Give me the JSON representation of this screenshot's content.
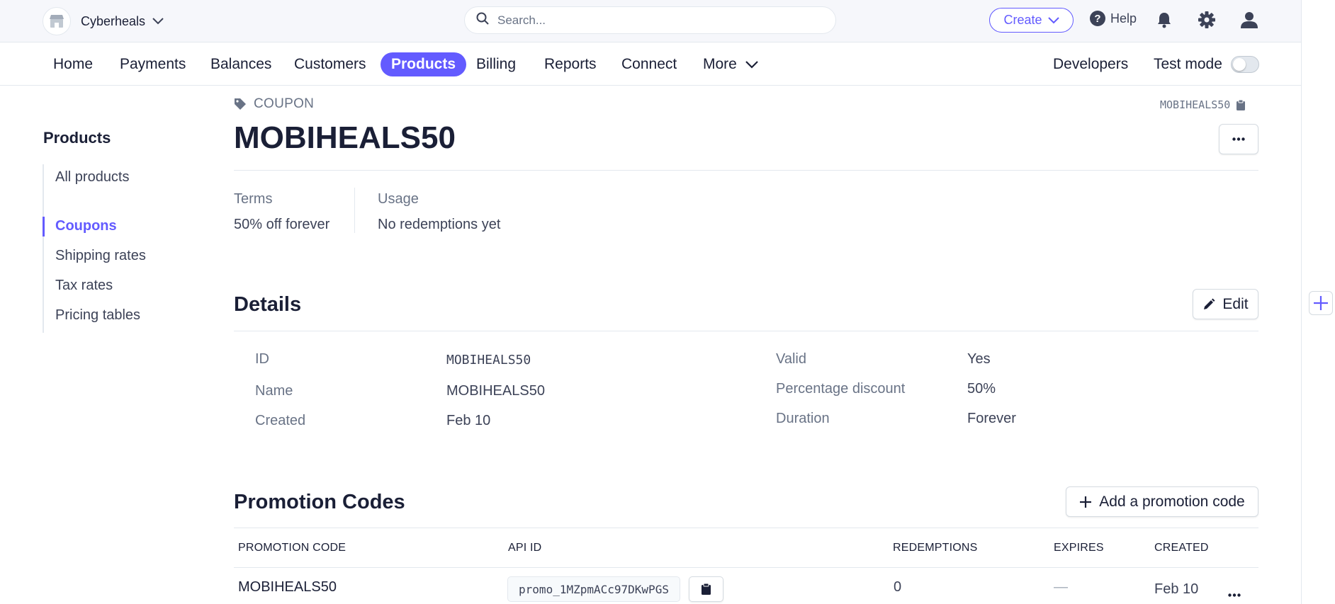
{
  "topbar": {
    "account_name": "Cyberheals",
    "search_placeholder": "Search...",
    "create_label": "Create",
    "help_label": "Help"
  },
  "nav": {
    "items": [
      "Home",
      "Payments",
      "Balances",
      "Customers",
      "Products",
      "Billing",
      "Reports",
      "Connect",
      "More"
    ],
    "active": "Products",
    "developers": "Developers",
    "test_mode": "Test mode",
    "test_mode_on": false
  },
  "sidebar": {
    "title": "Products",
    "items": [
      "All products",
      "Coupons",
      "Shipping rates",
      "Tax rates",
      "Pricing tables"
    ],
    "active": "Coupons"
  },
  "page": {
    "crumb": "COUPON",
    "id_top": "MOBIHEALS50",
    "title": "MOBIHEALS50"
  },
  "summary": {
    "terms_label": "Terms",
    "terms_value": "50% off forever",
    "usage_label": "Usage",
    "usage_value": "No redemptions yet"
  },
  "details": {
    "title": "Details",
    "edit_label": "Edit",
    "left": [
      {
        "label": "ID",
        "value": "MOBIHEALS50"
      },
      {
        "label": "Name",
        "value": "MOBIHEALS50"
      },
      {
        "label": "Created",
        "value": "Feb 10"
      }
    ],
    "right": [
      {
        "label": "Valid",
        "value": "Yes"
      },
      {
        "label": "Percentage discount",
        "value": "50%"
      },
      {
        "label": "Duration",
        "value": "Forever"
      }
    ]
  },
  "promotion_codes": {
    "title": "Promotion Codes",
    "add_label": "Add a promotion code",
    "columns": [
      "PROMOTION CODE",
      "API ID",
      "REDEMPTIONS",
      "EXPIRES",
      "CREATED"
    ],
    "rows": [
      {
        "code": "MOBIHEALS50",
        "api_id": "promo_1MZpmACc97DKwPGS",
        "redemptions": "0",
        "expires": "—",
        "created": "Feb 10"
      }
    ]
  },
  "colors": {
    "accent": "#635bff",
    "text": "#1a1f36",
    "muted": "#697386",
    "border": "#e3e8ee"
  },
  "icons": [
    "store-icon",
    "chevron-down-icon",
    "search-icon",
    "help-icon",
    "bell-icon",
    "gear-icon",
    "user-icon",
    "tag-icon",
    "clipboard-icon",
    "ellipsis-icon",
    "pencil-icon",
    "plus-icon"
  ]
}
